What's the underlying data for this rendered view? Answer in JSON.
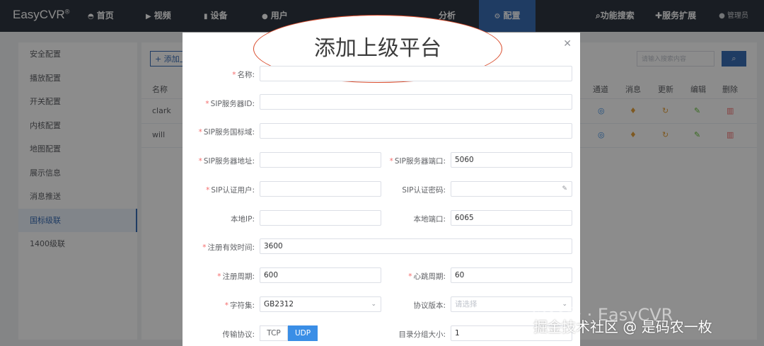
{
  "app": {
    "logo": "EasyCVR"
  },
  "nav": {
    "home": "首页",
    "video": "视频",
    "device": "设备",
    "user": "用户",
    "analysis": "分析",
    "config": "配置",
    "feature_search": "功能搜索",
    "service_ext": "服务扩展",
    "username": "管理员"
  },
  "sidebar": {
    "items": [
      "安全配置",
      "播放配置",
      "开关配置",
      "内核配置",
      "地图配置",
      "展示信息",
      "消息推送",
      "国标级联",
      "1400级联"
    ]
  },
  "content": {
    "add_button": "添加上",
    "search_placeholder": "请输入搜索内容",
    "columns": {
      "name": "名称",
      "channel": "通道",
      "message": "消息",
      "update": "更新",
      "edit": "编辑",
      "delete": "删除"
    },
    "rows": [
      {
        "name": "clark"
      },
      {
        "name": "will"
      }
    ]
  },
  "dialog": {
    "title": "添加上级平台",
    "fields": {
      "name": {
        "label": "名称:",
        "value": ""
      },
      "sip_id": {
        "label": "SIP服务器ID:",
        "value": ""
      },
      "sip_domain": {
        "label": "SIP服务国标域:",
        "value": ""
      },
      "sip_addr": {
        "label": "SIP服务器地址:",
        "value": ""
      },
      "sip_port": {
        "label": "SIP服务器端口:",
        "value": "5060"
      },
      "sip_user": {
        "label": "SIP认证用户:",
        "value": ""
      },
      "sip_pwd": {
        "label": "SIP认证密码:",
        "value": ""
      },
      "local_ip": {
        "label": "本地IP:",
        "value": ""
      },
      "local_port": {
        "label": "本地端口:",
        "value": "6065"
      },
      "reg_expire": {
        "label": "注册有效时间:",
        "value": "3600"
      },
      "reg_period": {
        "label": "注册周期:",
        "value": "600"
      },
      "heartbeat": {
        "label": "心跳周期:",
        "value": "60"
      },
      "charset": {
        "label": "字符集:",
        "value": "GB2312"
      },
      "protocol_version": {
        "label": "协议版本:",
        "placeholder": "请选择"
      },
      "transport": {
        "label": "传输协议:",
        "options": [
          "TCP",
          "UDP"
        ],
        "selected": "UDP"
      },
      "catalog_size": {
        "label": "目录分组大小:",
        "value": "1"
      }
    }
  },
  "watermark": {
    "line1": "公众号 · EasyCVR",
    "line2": "掘金技术社区 @ 是码农一枚"
  },
  "colors": {
    "accent": "#3a6db5",
    "required_star": "#f56c6c",
    "annotation": "#d94b2b"
  }
}
